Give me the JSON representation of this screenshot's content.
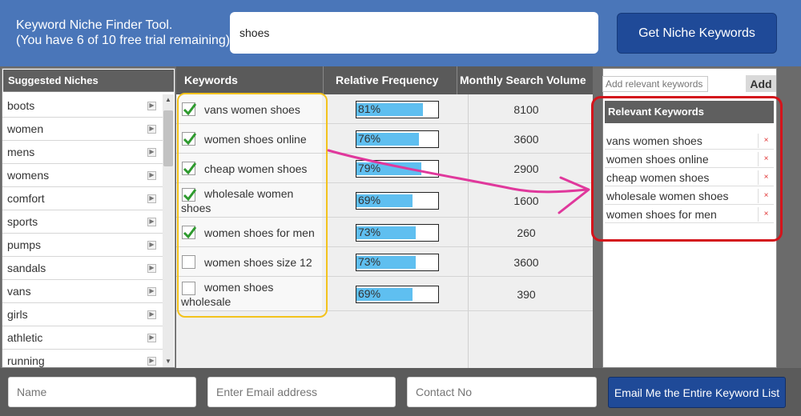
{
  "header": {
    "title_line1": "Keyword Niche Finder Tool.",
    "title_line2": "(You have 6 of 10 free trial remaining)",
    "search_value": "shoes",
    "niche_button": "Get Niche Keywords"
  },
  "niches": {
    "heading": "Suggested Niches",
    "items": [
      "boots",
      "women",
      "mens",
      "womens",
      "comfort",
      "sports",
      "pumps",
      "sandals",
      "vans",
      "girls",
      "athletic",
      "running"
    ]
  },
  "keywords": {
    "col_keywords": "Keywords",
    "col_frequency": "Relative Frequency",
    "col_volume": "Monthly Search Volume",
    "rows": [
      {
        "line1": "vans women shoes",
        "line2": "",
        "checked": true,
        "freq_label": "81%",
        "freq": 0.81,
        "volume": "8100"
      },
      {
        "line1": "women shoes online",
        "line2": "",
        "checked": true,
        "freq_label": "76%",
        "freq": 0.76,
        "volume": "3600"
      },
      {
        "line1": "cheap women shoes",
        "line2": "",
        "checked": true,
        "freq_label": "79%",
        "freq": 0.79,
        "volume": "2900"
      },
      {
        "line1": "wholesale women",
        "line2": "shoes",
        "checked": true,
        "freq_label": "69%",
        "freq": 0.69,
        "volume": "1600"
      },
      {
        "line1": "women shoes for men",
        "line2": "",
        "checked": true,
        "freq_label": "73%",
        "freq": 0.73,
        "volume": "260"
      },
      {
        "line1": "women shoes size 12",
        "line2": "",
        "checked": false,
        "freq_label": "73%",
        "freq": 0.73,
        "volume": "3600"
      },
      {
        "line1": "women shoes",
        "line2": "wholesale",
        "checked": false,
        "freq_label": "69%",
        "freq": 0.69,
        "volume": "390"
      }
    ]
  },
  "relevant": {
    "input_placeholder": "Add relevant keywords",
    "add_button": "Add",
    "heading": "Relevant Keywords",
    "remove_icon": "×",
    "items": [
      "vans women shoes",
      "women shoes online",
      "cheap women shoes",
      "wholesale women shoes",
      "women shoes for men"
    ]
  },
  "footer": {
    "name_placeholder": "Name",
    "email_placeholder": "Enter Email address",
    "contact_placeholder": "Contact No",
    "email_button": "Email Me the Entire Keyword List"
  },
  "colors": {
    "header_bg": "#4a76b9",
    "button_blue": "#1f4a98",
    "bar_fill": "#5fbff0",
    "check_green": "#2e9a2e",
    "highlight_yellow": "#f3c21c",
    "highlight_red": "#d4141b",
    "annotation_arrow": "#e0389c"
  },
  "icons": {
    "checkbox": "checkmark-icon",
    "niche_item": "arrow-right-icon",
    "remove": "close-icon"
  }
}
